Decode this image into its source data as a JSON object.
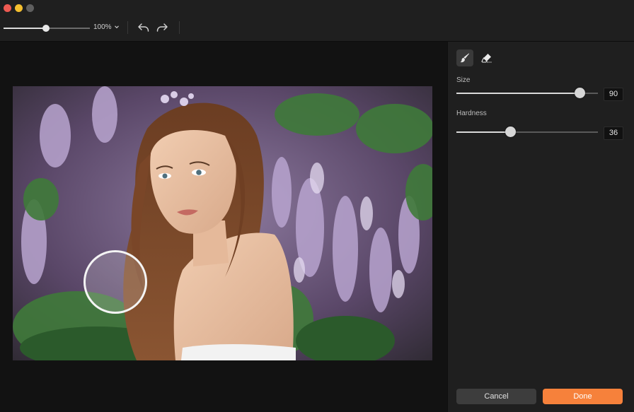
{
  "window": {
    "buttons": [
      "close",
      "minimize",
      "maximize"
    ]
  },
  "toolbar": {
    "zoom_label": "100%",
    "zoom_level": 0.49,
    "zoom_caret_icon": "chevron-down-icon",
    "undo_icon": "undo-icon",
    "redo_icon": "redo-icon"
  },
  "panel": {
    "tools": [
      {
        "name": "brush",
        "icon": "brush-icon",
        "active": true
      },
      {
        "name": "eraser",
        "icon": "eraser-icon",
        "active": false
      }
    ],
    "size": {
      "label": "Size",
      "value": "90",
      "level": 0.87
    },
    "hardness": {
      "label": "Hardness",
      "value": "36",
      "level": 0.38
    },
    "cancel_label": "Cancel",
    "done_label": "Done"
  },
  "colors": {
    "accent": "#f6813b",
    "panel_bg": "#1f1f1f",
    "canvas_bg": "#121212"
  }
}
